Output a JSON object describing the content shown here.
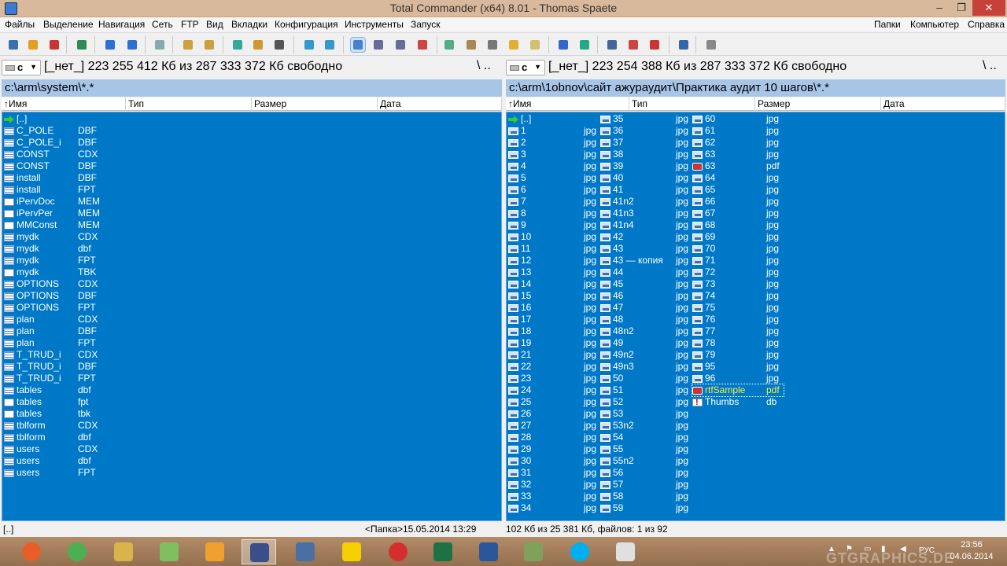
{
  "window": {
    "title": "Total Commander (x64) 8.01 - Thomas Spaete",
    "min": "–",
    "max": "❐",
    "close": "✕"
  },
  "menu": {
    "left": [
      "Файлы",
      "Выделение",
      "Навигация",
      "Сеть",
      "FTP",
      "Вид",
      "Вкладки",
      "Конфигурация",
      "Инструменты",
      "Запуск"
    ],
    "right": [
      "Папки",
      "Компьютер",
      "Справка"
    ]
  },
  "left": {
    "drive": "c",
    "drive_info": "[_нет_]  223 255 412 Кб из 287 333 372 Кб свободно",
    "root": "\\  ..",
    "path": "c:\\arm\\system\\*.*",
    "columns": [
      "↑Имя",
      "Тип",
      "Размер",
      "Дата"
    ],
    "status_left": "[..]",
    "status_right": "<Папка>15.05.2014 13:29",
    "files": [
      {
        "n": "[..]",
        "e": "",
        "i": "up"
      },
      {
        "n": "C_POLE",
        "e": "DBF",
        "i": "dbf"
      },
      {
        "n": "C_POLE_i",
        "e": "DBF",
        "i": "dbf"
      },
      {
        "n": "CONST",
        "e": "CDX",
        "i": "dbf"
      },
      {
        "n": "CONST",
        "e": "DBF",
        "i": "dbf"
      },
      {
        "n": "install",
        "e": "DBF",
        "i": "dbf"
      },
      {
        "n": "install",
        "e": "FPT",
        "i": "dbf"
      },
      {
        "n": "iPervDoc",
        "e": "MEM",
        "i": "file"
      },
      {
        "n": "iPervPer",
        "e": "MEM",
        "i": "file"
      },
      {
        "n": "MMConst",
        "e": "MEM",
        "i": "file"
      },
      {
        "n": "mydk",
        "e": "CDX",
        "i": "dbf"
      },
      {
        "n": "mydk",
        "e": "dbf",
        "i": "dbf"
      },
      {
        "n": "mydk",
        "e": "FPT",
        "i": "dbf"
      },
      {
        "n": "mydk",
        "e": "TBK",
        "i": "file"
      },
      {
        "n": "OPTIONS",
        "e": "CDX",
        "i": "dbf"
      },
      {
        "n": "OPTIONS",
        "e": "DBF",
        "i": "dbf"
      },
      {
        "n": "OPTIONS",
        "e": "FPT",
        "i": "dbf"
      },
      {
        "n": "plan",
        "e": "CDX",
        "i": "dbf"
      },
      {
        "n": "plan",
        "e": "DBF",
        "i": "dbf"
      },
      {
        "n": "plan",
        "e": "FPT",
        "i": "dbf"
      },
      {
        "n": "T_TRUD_i",
        "e": "CDX",
        "i": "dbf"
      },
      {
        "n": "T_TRUD_i",
        "e": "DBF",
        "i": "dbf"
      },
      {
        "n": "T_TRUD_i",
        "e": "FPT",
        "i": "dbf"
      },
      {
        "n": "tables",
        "e": "dbf",
        "i": "dbf"
      },
      {
        "n": "tables",
        "e": "fpt",
        "i": "file"
      },
      {
        "n": "tables",
        "e": "tbk",
        "i": "file"
      },
      {
        "n": "tblform",
        "e": "CDX",
        "i": "dbf"
      },
      {
        "n": "tblform",
        "e": "dbf",
        "i": "dbf"
      },
      {
        "n": "users",
        "e": "CDX",
        "i": "dbf"
      },
      {
        "n": "users",
        "e": "dbf",
        "i": "dbf"
      },
      {
        "n": "users",
        "e": "FPT",
        "i": "dbf"
      }
    ]
  },
  "right": {
    "drive": "c",
    "drive_info": "[_нет_]  223 254 388 Кб из 287 333 372 Кб свободно",
    "root": "\\  ..",
    "path": "c:\\arm\\1obnov\\сайт ажураудит\\Практика аудит 10 шагов\\*.*",
    "columns": [
      "↑Имя",
      "Тип",
      "Размер",
      "Дата"
    ],
    "status": "102 Кб из 25 381 Кб, файлов: 1 из 92",
    "col1": [
      {
        "n": "[..]",
        "e": "",
        "i": "up"
      },
      {
        "n": "1",
        "e": "jpg",
        "i": "img"
      },
      {
        "n": "2",
        "e": "jpg",
        "i": "img"
      },
      {
        "n": "3",
        "e": "jpg",
        "i": "img"
      },
      {
        "n": "4",
        "e": "jpg",
        "i": "img"
      },
      {
        "n": "5",
        "e": "jpg",
        "i": "img"
      },
      {
        "n": "6",
        "e": "jpg",
        "i": "img"
      },
      {
        "n": "7",
        "e": "jpg",
        "i": "img"
      },
      {
        "n": "8",
        "e": "jpg",
        "i": "img"
      },
      {
        "n": "9",
        "e": "jpg",
        "i": "img"
      },
      {
        "n": "10",
        "e": "jpg",
        "i": "img"
      },
      {
        "n": "11",
        "e": "jpg",
        "i": "img"
      },
      {
        "n": "12",
        "e": "jpg",
        "i": "img"
      },
      {
        "n": "13",
        "e": "jpg",
        "i": "img"
      },
      {
        "n": "14",
        "e": "jpg",
        "i": "img"
      },
      {
        "n": "15",
        "e": "jpg",
        "i": "img"
      },
      {
        "n": "16",
        "e": "jpg",
        "i": "img"
      },
      {
        "n": "17",
        "e": "jpg",
        "i": "img"
      },
      {
        "n": "18",
        "e": "jpg",
        "i": "img"
      },
      {
        "n": "19",
        "e": "jpg",
        "i": "img"
      },
      {
        "n": "21",
        "e": "jpg",
        "i": "img"
      },
      {
        "n": "22",
        "e": "jpg",
        "i": "img"
      },
      {
        "n": "23",
        "e": "jpg",
        "i": "img"
      },
      {
        "n": "24",
        "e": "jpg",
        "i": "img"
      },
      {
        "n": "25",
        "e": "jpg",
        "i": "img"
      },
      {
        "n": "26",
        "e": "jpg",
        "i": "img"
      },
      {
        "n": "27",
        "e": "jpg",
        "i": "img"
      },
      {
        "n": "28",
        "e": "jpg",
        "i": "img"
      },
      {
        "n": "29",
        "e": "jpg",
        "i": "img"
      },
      {
        "n": "30",
        "e": "jpg",
        "i": "img"
      },
      {
        "n": "31",
        "e": "jpg",
        "i": "img"
      },
      {
        "n": "32",
        "e": "jpg",
        "i": "img"
      },
      {
        "n": "33",
        "e": "jpg",
        "i": "img"
      },
      {
        "n": "34",
        "e": "jpg",
        "i": "img"
      }
    ],
    "col2": [
      {
        "n": "35",
        "e": "jpg",
        "i": "img"
      },
      {
        "n": "36",
        "e": "jpg",
        "i": "img"
      },
      {
        "n": "37",
        "e": "jpg",
        "i": "img"
      },
      {
        "n": "38",
        "e": "jpg",
        "i": "img"
      },
      {
        "n": "39",
        "e": "jpg",
        "i": "img"
      },
      {
        "n": "40",
        "e": "jpg",
        "i": "img"
      },
      {
        "n": "41",
        "e": "jpg",
        "i": "img"
      },
      {
        "n": "41n2",
        "e": "jpg",
        "i": "img"
      },
      {
        "n": "41n3",
        "e": "jpg",
        "i": "img"
      },
      {
        "n": "41n4",
        "e": "jpg",
        "i": "img"
      },
      {
        "n": "42",
        "e": "jpg",
        "i": "img"
      },
      {
        "n": "43",
        "e": "jpg",
        "i": "img"
      },
      {
        "n": "43 — копия",
        "e": "jpg",
        "i": "img"
      },
      {
        "n": "44",
        "e": "jpg",
        "i": "img"
      },
      {
        "n": "45",
        "e": "jpg",
        "i": "img"
      },
      {
        "n": "46",
        "e": "jpg",
        "i": "img"
      },
      {
        "n": "47",
        "e": "jpg",
        "i": "img"
      },
      {
        "n": "48",
        "e": "jpg",
        "i": "img"
      },
      {
        "n": "48n2",
        "e": "jpg",
        "i": "img"
      },
      {
        "n": "49",
        "e": "jpg",
        "i": "img"
      },
      {
        "n": "49n2",
        "e": "jpg",
        "i": "img"
      },
      {
        "n": "49n3",
        "e": "jpg",
        "i": "img"
      },
      {
        "n": "50",
        "e": "jpg",
        "i": "img"
      },
      {
        "n": "51",
        "e": "jpg",
        "i": "img"
      },
      {
        "n": "52",
        "e": "jpg",
        "i": "img"
      },
      {
        "n": "53",
        "e": "jpg",
        "i": "img"
      },
      {
        "n": "53n2",
        "e": "jpg",
        "i": "img"
      },
      {
        "n": "54",
        "e": "jpg",
        "i": "img"
      },
      {
        "n": "55",
        "e": "jpg",
        "i": "img"
      },
      {
        "n": "55n2",
        "e": "jpg",
        "i": "img"
      },
      {
        "n": "56",
        "e": "jpg",
        "i": "img"
      },
      {
        "n": "57",
        "e": "jpg",
        "i": "img"
      },
      {
        "n": "58",
        "e": "jpg",
        "i": "img"
      },
      {
        "n": "59",
        "e": "jpg",
        "i": "img"
      }
    ],
    "col3": [
      {
        "n": "60",
        "e": "jpg",
        "i": "img"
      },
      {
        "n": "61",
        "e": "jpg",
        "i": "img"
      },
      {
        "n": "62",
        "e": "jpg",
        "i": "img"
      },
      {
        "n": "63",
        "e": "jpg",
        "i": "img"
      },
      {
        "n": "63",
        "e": "pdf",
        "i": "pdf"
      },
      {
        "n": "64",
        "e": "jpg",
        "i": "img"
      },
      {
        "n": "65",
        "e": "jpg",
        "i": "img"
      },
      {
        "n": "66",
        "e": "jpg",
        "i": "img"
      },
      {
        "n": "67",
        "e": "jpg",
        "i": "img"
      },
      {
        "n": "68",
        "e": "jpg",
        "i": "img"
      },
      {
        "n": "69",
        "e": "jpg",
        "i": "img"
      },
      {
        "n": "70",
        "e": "jpg",
        "i": "img"
      },
      {
        "n": "71",
        "e": "jpg",
        "i": "img"
      },
      {
        "n": "72",
        "e": "jpg",
        "i": "img"
      },
      {
        "n": "73",
        "e": "jpg",
        "i": "img"
      },
      {
        "n": "74",
        "e": "jpg",
        "i": "img"
      },
      {
        "n": "75",
        "e": "jpg",
        "i": "img"
      },
      {
        "n": "76",
        "e": "jpg",
        "i": "img"
      },
      {
        "n": "77",
        "e": "jpg",
        "i": "img"
      },
      {
        "n": "78",
        "e": "jpg",
        "i": "img"
      },
      {
        "n": "79",
        "e": "jpg",
        "i": "img"
      },
      {
        "n": "95",
        "e": "jpg",
        "i": "img"
      },
      {
        "n": "96",
        "e": "jpg",
        "i": "img"
      },
      {
        "n": "rtfSample",
        "e": "pdf",
        "i": "pdf",
        "sel": true
      },
      {
        "n": "Thumbs",
        "e": "db",
        "i": "warn"
      }
    ]
  },
  "toolbar_icons": [
    "refresh-icon",
    "settings-icon",
    "plugin-icon",
    "sync-icon",
    "back-icon",
    "forward-icon",
    "compare-icon",
    "pack-icon",
    "unpack-icon",
    "find-icon",
    "sort-icon",
    "notepad-icon",
    "ftp-icon",
    "network-icon",
    "brief-view-icon",
    "full-view-icon",
    "tree-view-icon",
    "thumbs-view-icon",
    "copy-icon",
    "rename-icon",
    "calc-icon",
    "folder-icon",
    "edit-icon",
    "share-icon",
    "drive-icon",
    "screen-icon",
    "multirename-icon",
    "add-icon",
    "internet-icon",
    "pencil-icon"
  ],
  "taskbar": {
    "apps": [
      "Opera-like",
      "Chrome",
      "Explorer",
      "Notes",
      "Photo",
      "Total Commander",
      "Remote",
      "Security",
      "Opera",
      "Excel",
      "Word",
      "Files",
      "Skype",
      "PDF"
    ],
    "lang": "РУС",
    "time": "23:56",
    "date": "04.06.2014"
  },
  "watermark": "GTGRAPHICS.DE",
  "colors": {
    "panel": "#0078c8",
    "path": "#a7c5e6",
    "taskbar": "#a57e5d",
    "titlebar": "#d9b99b",
    "selected_text": "#ffeb3b"
  }
}
